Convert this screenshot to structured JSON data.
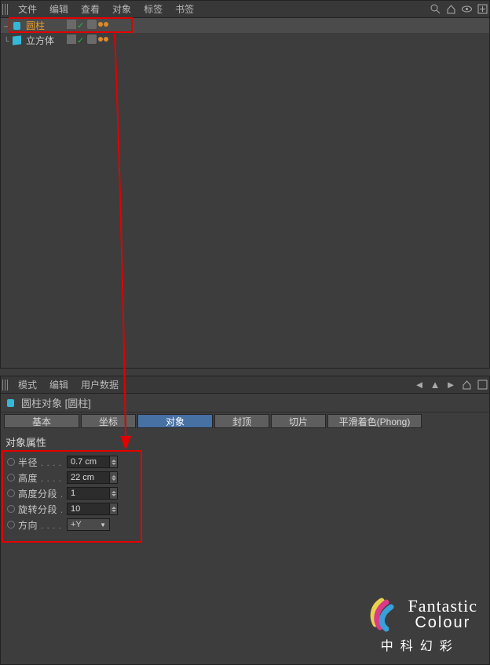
{
  "object_manager": {
    "menus": {
      "file": "文件",
      "edit": "编辑",
      "view": "查看",
      "object": "对象",
      "tags": "标签",
      "bookmarks": "书签"
    },
    "tool_icons": {
      "search": "search-icon",
      "home": "home-icon",
      "eye": "eye-icon",
      "new": "new-icon"
    },
    "tree": [
      {
        "name": "圆柱",
        "selected": true
      },
      {
        "name": "立方体",
        "selected": false
      }
    ]
  },
  "attribute_manager": {
    "menus": {
      "mode": "模式",
      "edit": "编辑",
      "userdata": "用户数据"
    },
    "nav_icons": {
      "back": "arrow-left-icon",
      "fwd": "arrow-right-icon",
      "up": "arrow-up-icon",
      "home": "home-icon",
      "max": "maximize-icon"
    },
    "header": "圆柱对象 [圆柱]",
    "tabs": {
      "basic": "基本",
      "coord": "坐标",
      "object": "对象",
      "caps": "封顶",
      "slice": "切片",
      "phong": "平滑着色(Phong)"
    },
    "active_tab": "object",
    "section_title": "对象属性",
    "props": {
      "radius": {
        "label": "半径",
        "value": "0.7 cm"
      },
      "height": {
        "label": "高度",
        "value": "22 cm"
      },
      "hseg": {
        "label": "高度分段",
        "value": "1"
      },
      "rseg": {
        "label": "旋转分段",
        "value": "10"
      },
      "orient": {
        "label": "方向",
        "value": "+Y"
      }
    }
  },
  "brand": {
    "line1": "Fantastic",
    "line2": "Colour",
    "cn": "中科幻彩"
  }
}
